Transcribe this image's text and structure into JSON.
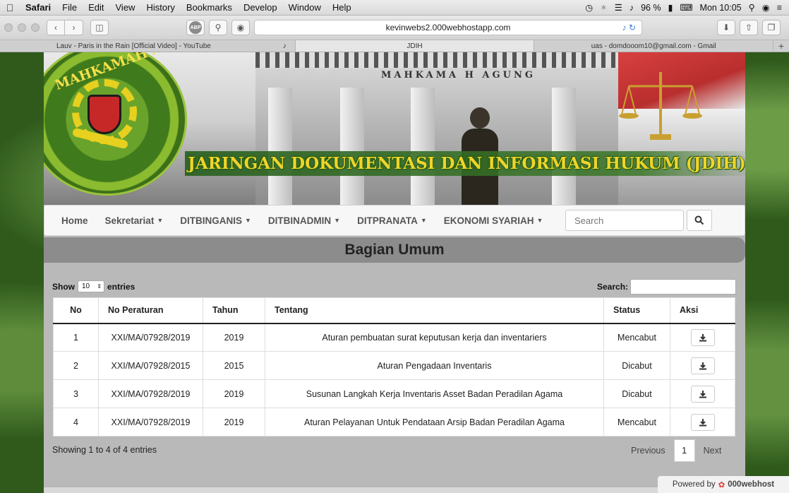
{
  "menubar": {
    "apple": "",
    "app": "Safari",
    "items": [
      "File",
      "Edit",
      "View",
      "History",
      "Bookmarks",
      "Develop",
      "Window",
      "Help"
    ],
    "battery": "96 %",
    "time": "Mon 10:05"
  },
  "toolbar": {
    "abp_label": "ABP",
    "url": "kevinwebs2.000webhostapp.com"
  },
  "tabs": [
    {
      "label": "Lauv - Paris in the Rain [Official Video] - YouTube",
      "audio": true,
      "active": false
    },
    {
      "label": "JDIH",
      "audio": false,
      "active": true
    },
    {
      "label": "uas - domdooom10@gmail.com - Gmail",
      "audio": false,
      "active": false
    }
  ],
  "banner": {
    "inscription": "MAHKAMA H AGUNG",
    "logo_text": "MAHKAMAH AGUNG",
    "title": "JARINGAN DOKUMENTASI DAN INFORMASI HUKUM (JDIH)"
  },
  "nav": {
    "items": [
      {
        "label": "Home",
        "caret": false
      },
      {
        "label": "Sekretariat",
        "caret": true
      },
      {
        "label": "DITBINGANIS",
        "caret": true
      },
      {
        "label": "DITBINADMIN",
        "caret": true
      },
      {
        "label": "DITPRANATA",
        "caret": true
      },
      {
        "label": "EKONOMI SYARIAH",
        "caret": true
      }
    ],
    "search_placeholder": "Search"
  },
  "section_title": "Bagian Umum",
  "datatable": {
    "show_label": "Show",
    "entries_value": "10",
    "entries_label": "entries",
    "search_label": "Search:",
    "columns": [
      "No",
      "No Peraturan",
      "Tahun",
      "Tentang",
      "Status",
      "Aksi"
    ],
    "rows": [
      {
        "no": "1",
        "peraturan": "XXI/MA/07928/2019",
        "tahun": "2019",
        "tentang": "Aturan pembuatan surat keputusan kerja dan inventariers",
        "status": "Mencabut"
      },
      {
        "no": "2",
        "peraturan": "XXI/MA/07928/2015",
        "tahun": "2015",
        "tentang": "Aturan Pengadaan Inventaris",
        "status": "Dicabut"
      },
      {
        "no": "3",
        "peraturan": "XXI/MA/07928/2019",
        "tahun": "2019",
        "tentang": "Susunan Langkah Kerja Inventaris Asset Badan Peradilan Agama",
        "status": "Dicabut"
      },
      {
        "no": "4",
        "peraturan": "XXI/MA/07928/2019",
        "tahun": "2019",
        "tentang": "Aturan Pelayanan Untuk Pendataan Arsip Badan Peradilan Agama",
        "status": "Mencabut"
      }
    ],
    "info": "Showing 1 to 4 of 4 entries",
    "previous": "Previous",
    "page": "1",
    "next": "Next"
  },
  "powered": {
    "prefix": "Powered by",
    "brand": "000webhost"
  },
  "colors": {
    "page_bg": "#2f5a1c",
    "container_bg": "#b9b9b9",
    "section_title_bg": "#8c8c8c",
    "banner_title": "#f0d42a"
  }
}
